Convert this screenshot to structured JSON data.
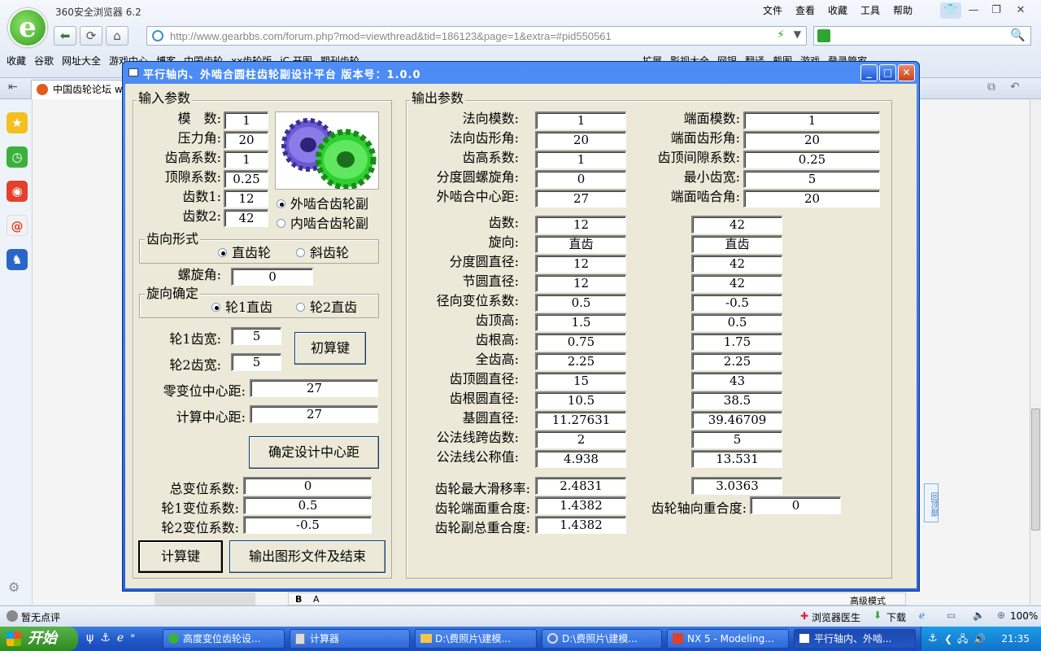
{
  "browser": {
    "name": "360安全浏览器 6.2",
    "menu": [
      "文件",
      "查看",
      "收藏",
      "工具",
      "帮助"
    ],
    "url": "http://www.gearbbs.com/forum.php?mod=viewthread&tid=186123&page=1&extra=#pid550561",
    "url_host": "gearbbs.com",
    "bookmarks": [
      "收藏",
      "谷歌",
      "网址大全",
      "游戏中心",
      "博客",
      "中国齿轮",
      "xx齿轮版",
      "iC 开图",
      "期刊齿轮",
      "扩展",
      "影视大全",
      "网银",
      "翻译",
      "截图",
      "游戏",
      "登录管家"
    ],
    "tab_label": "中国齿轮论坛 w",
    "status_left": "暂无点评",
    "status_right": [
      "浏览器医生",
      "下载",
      "100%"
    ],
    "editor_right": "高级模式"
  },
  "taskbar": {
    "start": "开始",
    "items": [
      "高度变位齿轮设...",
      "计算器",
      "D:\\费照片\\建模...",
      "D:\\费照片\\建模...",
      "NX 5 - Modeling...",
      "平行轴内、外啮..."
    ],
    "clock": "21:35"
  },
  "back_to_top": "回顶部",
  "dialog": {
    "title": "平行轴内、外啮合圆柱齿轮副设计平台 版本号：1.0.0",
    "input_group": "输入参数",
    "output_group": "输出参数",
    "inputs": {
      "module_label": "模　数:",
      "module": "1",
      "pressure_label": "压力角:",
      "pressure": "20",
      "addendum_label": "齿高系数:",
      "addendum": "1",
      "clearance_label": "顶隙系数:",
      "clearance": "0.25",
      "z1_label": "齿数1:",
      "z1": "12",
      "z2_label": "齿数2:",
      "z2": "42"
    },
    "mesh_options": [
      "外啮合齿轮副",
      "内啮合齿轮副"
    ],
    "tooth_form_group": "齿向形式",
    "tooth_form_options": [
      "直齿轮",
      "斜齿轮"
    ],
    "helix_label": "螺旋角:",
    "helix": "0",
    "direction_group": "旋向确定",
    "direction_options": [
      "轮1直齿",
      "轮2直齿"
    ],
    "width1_label": "轮1齿宽:",
    "width1": "5",
    "width2_label": "轮2齿宽:",
    "width2": "5",
    "precalc_button": "初算键",
    "zero_shift_label": "零变位中心距:",
    "zero_shift": "27",
    "calc_center_label": "计算中心距:",
    "calc_center": "27",
    "confirm_button": "确定设计中心距",
    "total_shift_label": "总变位系数:",
    "total_shift": "0",
    "shift1_label": "轮1变位系数:",
    "shift1": "0.5",
    "shift2_label": "轮2变位系数:",
    "shift2": "-0.5",
    "calc_button": "计算键",
    "export_button": "输出图形文件及结束",
    "out_top": [
      {
        "label": "法向模数:",
        "value": "1",
        "label2": "端面模数:",
        "value2": "1"
      },
      {
        "label": "法向齿形角:",
        "value": "20",
        "label2": "端面齿形角:",
        "value2": "20"
      },
      {
        "label": "齿高系数:",
        "value": "1",
        "label2": "齿顶间隙系数:",
        "value2": "0.25"
      },
      {
        "label": "分度圆螺旋角:",
        "value": "0",
        "label2": "最小齿宽:",
        "value2": "5"
      },
      {
        "label": "外啮合中心距:",
        "value": "27",
        "label2": "端面啮合角:",
        "value2": "20"
      }
    ],
    "out_rows": [
      {
        "label": "齿数:",
        "g1": "12",
        "g2": "42"
      },
      {
        "label": "旋向:",
        "g1": "直齿",
        "g2": "直齿"
      },
      {
        "label": "分度圆直径:",
        "g1": "12",
        "g2": "42"
      },
      {
        "label": "节圆直径:",
        "g1": "12",
        "g2": "42"
      },
      {
        "label": "径向变位系数:",
        "g1": "0.5",
        "g2": "-0.5"
      },
      {
        "label": "齿顶高:",
        "g1": "1.5",
        "g2": "0.5"
      },
      {
        "label": "齿根高:",
        "g1": "0.75",
        "g2": "1.75"
      },
      {
        "label": "全齿高:",
        "g1": "2.25",
        "g2": "2.25"
      },
      {
        "label": "齿顶圆直径:",
        "g1": "15",
        "g2": "43"
      },
      {
        "label": "齿根圆直径:",
        "g1": "10.5",
        "g2": "38.5"
      },
      {
        "label": "基圆直径:",
        "g1": "11.27631",
        "g2": "39.46709"
      },
      {
        "label": "公法线跨齿数:",
        "g1": "2",
        "g2": "5"
      },
      {
        "label": "公法线公称值:",
        "g1": "4.938",
        "g2": "13.531"
      }
    ],
    "slip_label": "齿轮最大滑移率:",
    "slip1": "2.4831",
    "slip2": "3.0363",
    "transverse_label": "齿轮端面重合度:",
    "transverse": "1.4382",
    "axial_label": "齿轮轴向重合度:",
    "axial": "0",
    "total_contact_label": "齿轮副总重合度:",
    "total_contact": "1.4382"
  }
}
